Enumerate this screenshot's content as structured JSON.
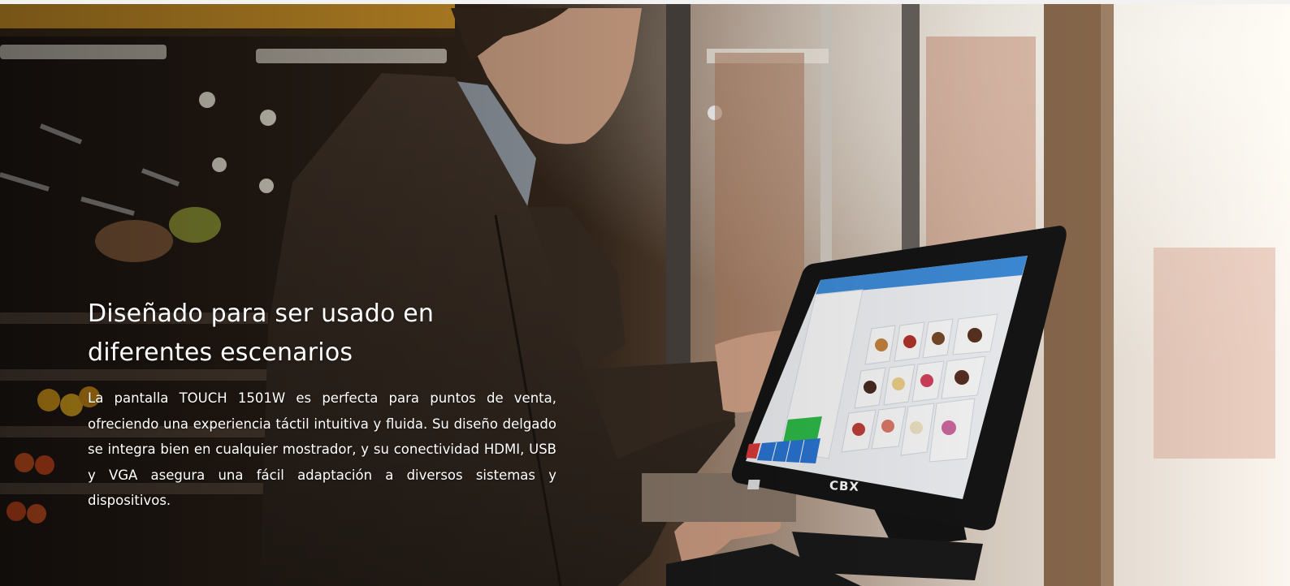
{
  "hero": {
    "title": "Diseñado para ser usado en diferentes escenarios",
    "body": "La pantalla TOUCH 1501W es perfecta para puntos de venta, ofreciendo una experiencia táctil intuitiva y fluida. Su diseño delgado se integra bien en cualquier mostrador, y su conectividad HDMI, USB y VGA asegura una fácil adaptación a diversos sistemas y dispositivos.",
    "brand_logo_text": "CBX"
  },
  "colors": {
    "page_background": "#f2f2f2",
    "text": "#ffffff",
    "accent_ceiling_beam": "#d79a2a",
    "screen_header_blue": "#3f8fde",
    "screen_button_green": "#2fbf4b",
    "screen_button_red": "#e03a3a",
    "screen_button_blue": "#2b78d8"
  }
}
